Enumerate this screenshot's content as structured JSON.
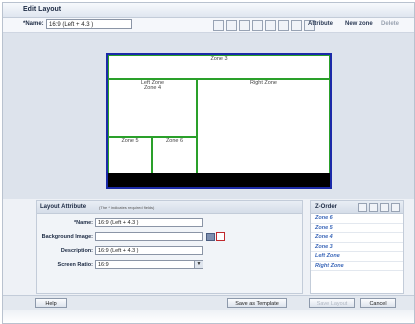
{
  "window": {
    "title": "Edit Layout"
  },
  "name_bar": {
    "label": "*Name:",
    "value": "16:9 (Left + 4.3 )",
    "attribute_label": "Attribute",
    "new_zone_label": "New zone",
    "delete_label": "Delete"
  },
  "zones": {
    "zone3": "Zone 3",
    "left_zone": "Left Zone",
    "zone4": "Zone 4",
    "right_zone": "Right Zone",
    "zone5": "Zone 5",
    "zone6": "Zone 6"
  },
  "attributes": {
    "title": "Layout Attribute",
    "note": "(The * indicates required fields)",
    "name_label": "*Name:",
    "name_value": "16:9 (Left + 4.3 )",
    "bg_label": "Background Image:",
    "bg_value": "",
    "desc_label": "Description:",
    "desc_value": "16:9 (Left + 4.3 )",
    "ratio_label": "Screen Ratio:",
    "ratio_value": "16:9"
  },
  "zorder": {
    "title": "Z-Order",
    "items": [
      "Zone 6",
      "Zone 5",
      "Zone 4",
      "Zone 3",
      "Left Zone",
      "Right Zone"
    ]
  },
  "footer": {
    "help": "Help",
    "save_template": "Save as Template",
    "save_layout": "Save Layout",
    "cancel": "Cancel"
  },
  "colors": {
    "screen_border": "#1b2aa8",
    "zone_border": "#2aa02a",
    "zorder_text": "#3a66b8"
  }
}
